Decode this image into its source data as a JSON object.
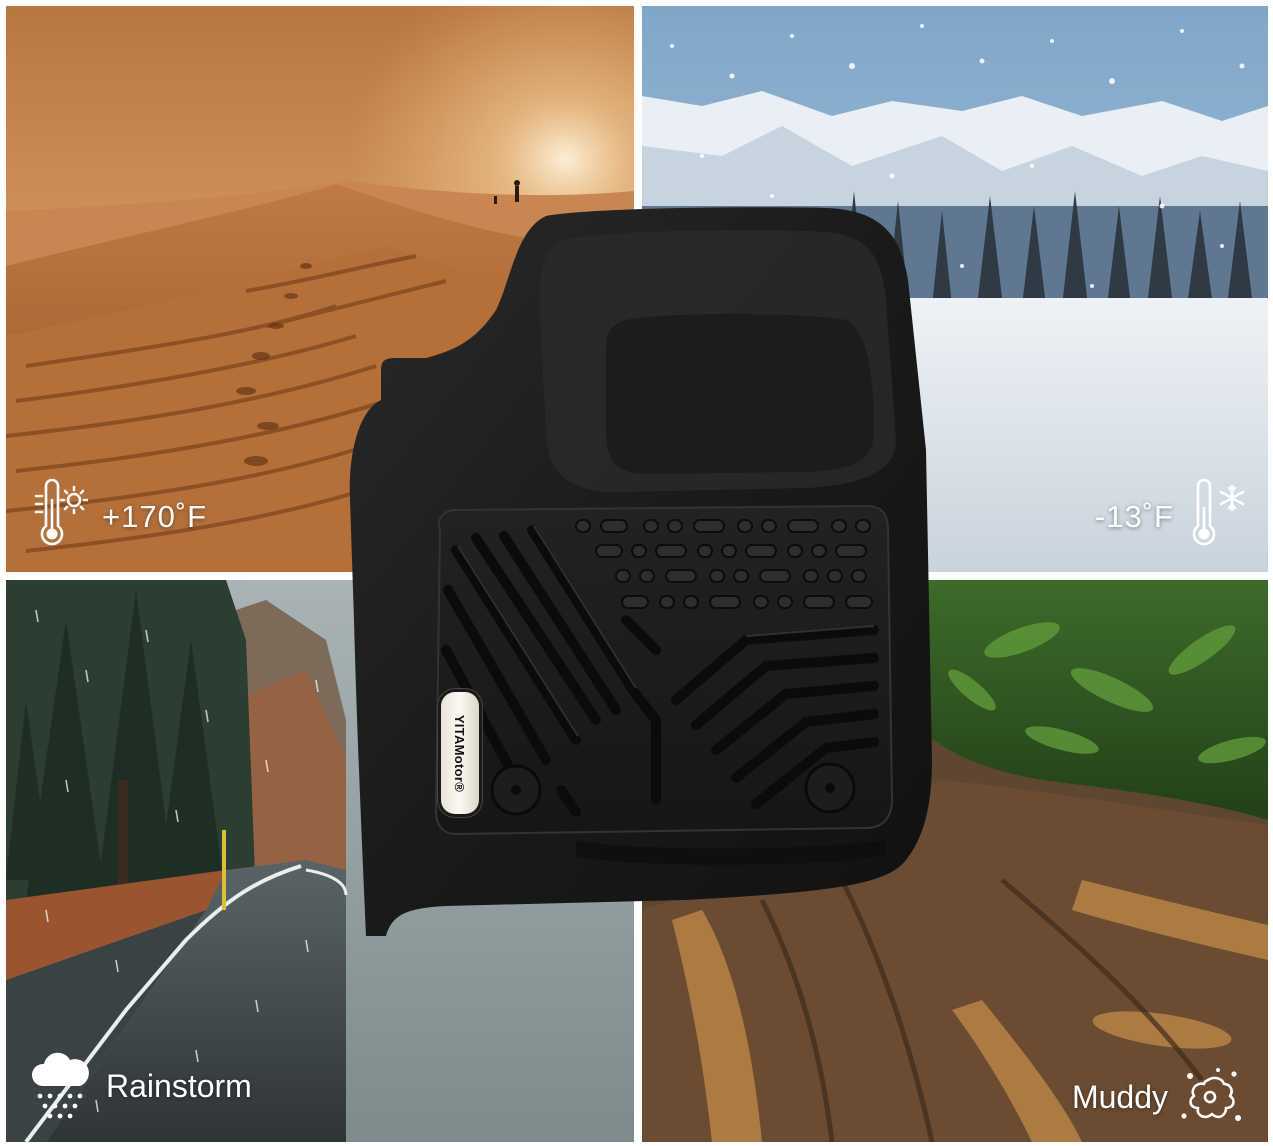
{
  "panels": {
    "desert": {
      "label": "+170˚F",
      "icon": "thermometer-sun-icon"
    },
    "snow": {
      "label": "-13˚F",
      "icon": "thermometer-snowflake-icon"
    },
    "rain": {
      "label": "Rainstorm",
      "icon": "cloud-rain-icon"
    },
    "mud": {
      "label": "Muddy",
      "icon": "mud-splash-icon"
    }
  },
  "product": {
    "brand": "YITAMotor®",
    "item": "floor-mat"
  },
  "colors": {
    "caption_text": "#ffffff",
    "mat": "#1c1c1c",
    "desert": "#c98a52",
    "snow": "#dfe6ee",
    "rain": "#4c5a4f",
    "mud": "#6d4f33"
  }
}
